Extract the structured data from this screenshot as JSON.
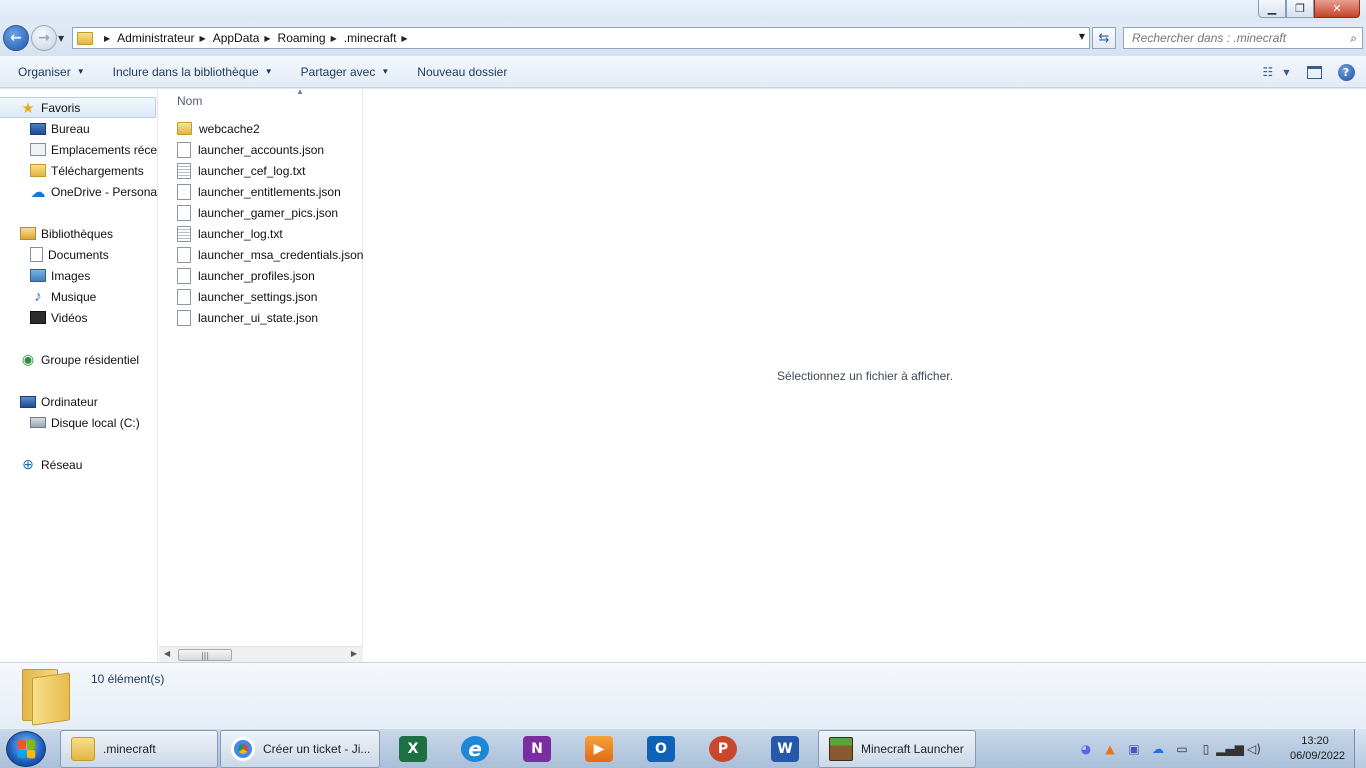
{
  "window": {
    "minimize": "▁",
    "maximize": "❐",
    "close": "✕"
  },
  "address": {
    "crumbs": [
      "Administrateur",
      "AppData",
      "Roaming",
      ".minecraft"
    ]
  },
  "search": {
    "placeholder": "Rechercher dans : .minecraft"
  },
  "toolbar": {
    "organize": "Organiser",
    "include_library": "Inclure dans la bibliothèque",
    "share_with": "Partager avec",
    "new_folder": "Nouveau dossier"
  },
  "nav": {
    "favorites": "Favoris",
    "desktop": "Bureau",
    "recent": "Emplacements récents",
    "downloads": "Téléchargements",
    "onedrive": "OneDrive - Personal",
    "libraries": "Bibliothèques",
    "documents": "Documents",
    "images": "Images",
    "music": "Musique",
    "videos": "Vidéos",
    "homegroup": "Groupe résidentiel",
    "computer": "Ordinateur",
    "local_disk": "Disque local (C:)",
    "network": "Réseau"
  },
  "files": {
    "column_name": "Nom",
    "items": [
      {
        "name": "webcache2",
        "kind": "folder"
      },
      {
        "name": "launcher_accounts.json",
        "kind": "file"
      },
      {
        "name": "launcher_cef_log.txt",
        "kind": "txt"
      },
      {
        "name": "launcher_entitlements.json",
        "kind": "file"
      },
      {
        "name": "launcher_gamer_pics.json",
        "kind": "file"
      },
      {
        "name": "launcher_log.txt",
        "kind": "txt"
      },
      {
        "name": "launcher_msa_credentials.json",
        "kind": "file"
      },
      {
        "name": "launcher_profiles.json",
        "kind": "file"
      },
      {
        "name": "launcher_settings.json",
        "kind": "file"
      },
      {
        "name": "launcher_ui_state.json",
        "kind": "file"
      }
    ]
  },
  "preview": {
    "message": "Sélectionnez un fichier à afficher."
  },
  "details": {
    "count": "10 élément(s)"
  },
  "taskbar": {
    "explorer_label": ".minecraft",
    "chrome_label": "Créer un ticket - Ji...",
    "minecraft_label": "Minecraft Launcher",
    "excel_letter": "X",
    "onenote_letter": "N",
    "outlook_letter": "O",
    "powerpoint_letter": "P",
    "word_letter": "W",
    "ie_letter": "e",
    "time": "13:20",
    "date": "06/09/2022"
  },
  "colors": {
    "excel": "#1d7044",
    "onenote": "#7b2c9e",
    "outlook": "#0f62b8",
    "powerpoint": "#c9472b",
    "word": "#2657a8",
    "ie": "#1e88d6"
  }
}
